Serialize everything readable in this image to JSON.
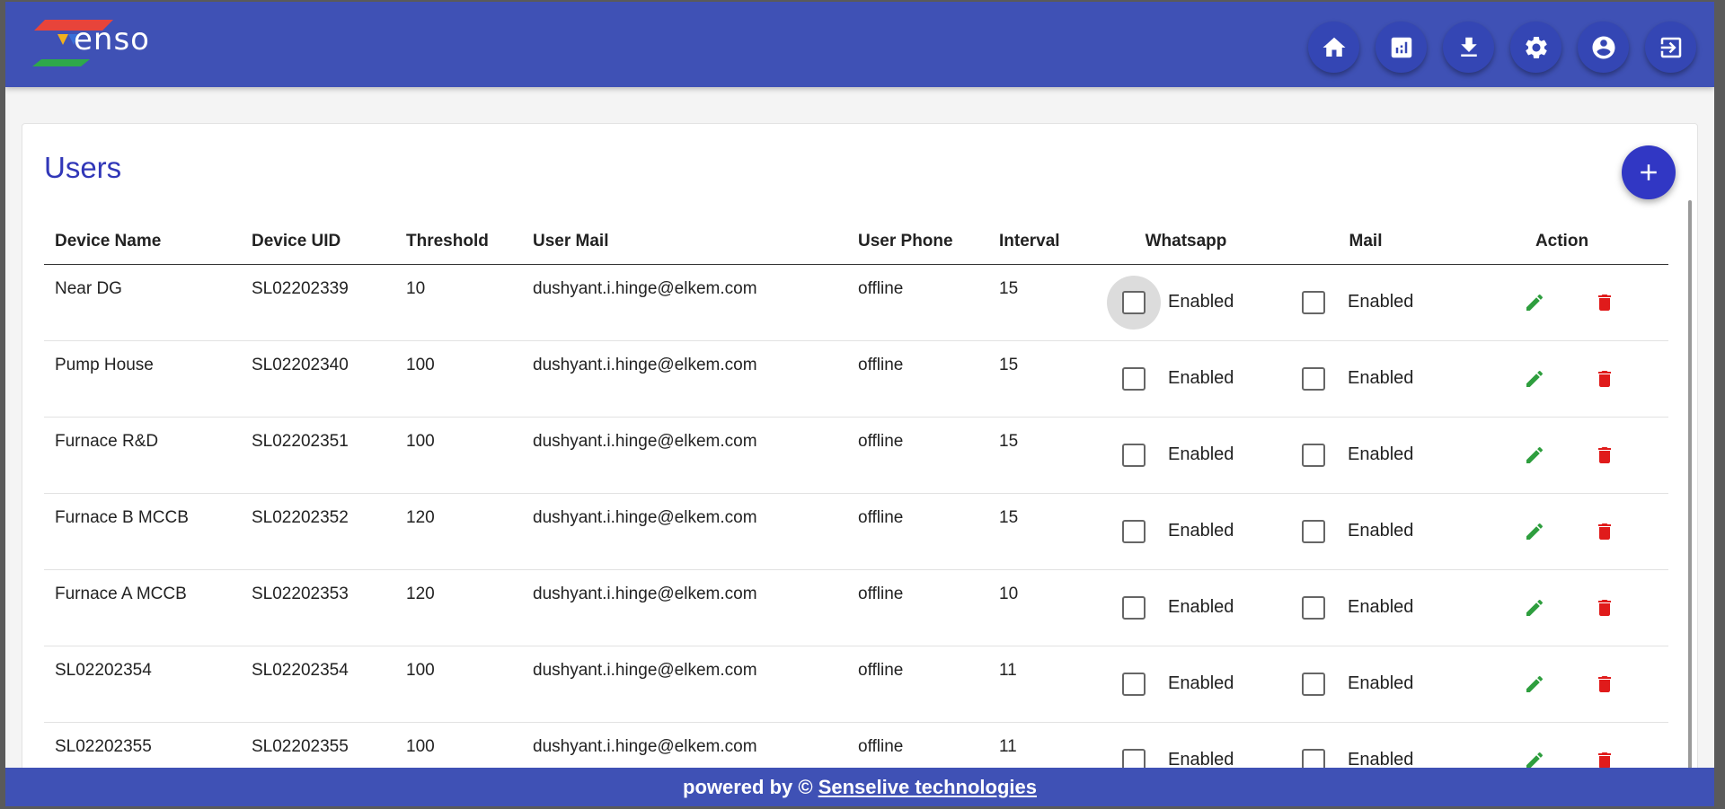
{
  "app": {
    "logo_text": "enso",
    "colors": {
      "header": "#3f51b5",
      "accent": "#3137b8",
      "edit": "#2e9e3e",
      "delete": "#e01b1b"
    }
  },
  "nav": [
    {
      "icon": "home-icon"
    },
    {
      "icon": "report-icon"
    },
    {
      "icon": "download-icon"
    },
    {
      "icon": "settings-icon"
    },
    {
      "icon": "account-icon"
    },
    {
      "icon": "logout-icon"
    }
  ],
  "page": {
    "title": "Users",
    "add_icon": "plus-icon"
  },
  "table": {
    "headers": [
      "Device Name",
      "Device UID",
      "Threshold",
      "User Mail",
      "User Phone",
      "Interval",
      "Whatsapp",
      "Mail",
      "Action"
    ],
    "checkbox_label": "Enabled",
    "rows": [
      {
        "device_name": "Near DG",
        "device_uid": "SL02202339",
        "threshold": "10",
        "user_mail": "dushyant.i.hinge@elkem.com",
        "user_phone": "offline",
        "interval": "15",
        "whatsapp": false,
        "mail": false
      },
      {
        "device_name": "Pump House",
        "device_uid": "SL02202340",
        "threshold": "100",
        "user_mail": "dushyant.i.hinge@elkem.com",
        "user_phone": "offline",
        "interval": "15",
        "whatsapp": false,
        "mail": false
      },
      {
        "device_name": "Furnace R&D",
        "device_uid": "SL02202351",
        "threshold": "100",
        "user_mail": "dushyant.i.hinge@elkem.com",
        "user_phone": "offline",
        "interval": "15",
        "whatsapp": false,
        "mail": false
      },
      {
        "device_name": "Furnace B MCCB",
        "device_uid": "SL02202352",
        "threshold": "120",
        "user_mail": "dushyant.i.hinge@elkem.com",
        "user_phone": "offline",
        "interval": "15",
        "whatsapp": false,
        "mail": false
      },
      {
        "device_name": "Furnace A MCCB",
        "device_uid": "SL02202353",
        "threshold": "120",
        "user_mail": "dushyant.i.hinge@elkem.com",
        "user_phone": "offline",
        "interval": "10",
        "whatsapp": false,
        "mail": false
      },
      {
        "device_name": "SL02202354",
        "device_uid": "SL02202354",
        "threshold": "100",
        "user_mail": "dushyant.i.hinge@elkem.com",
        "user_phone": "offline",
        "interval": "11",
        "whatsapp": false,
        "mail": false
      },
      {
        "device_name": "SL02202355",
        "device_uid": "SL02202355",
        "threshold": "100",
        "user_mail": "dushyant.i.hinge@elkem.com",
        "user_phone": "offline",
        "interval": "11",
        "whatsapp": false,
        "mail": false
      }
    ]
  },
  "footer": {
    "prefix": "powered by © ",
    "link_text": "Senselive technologies"
  }
}
